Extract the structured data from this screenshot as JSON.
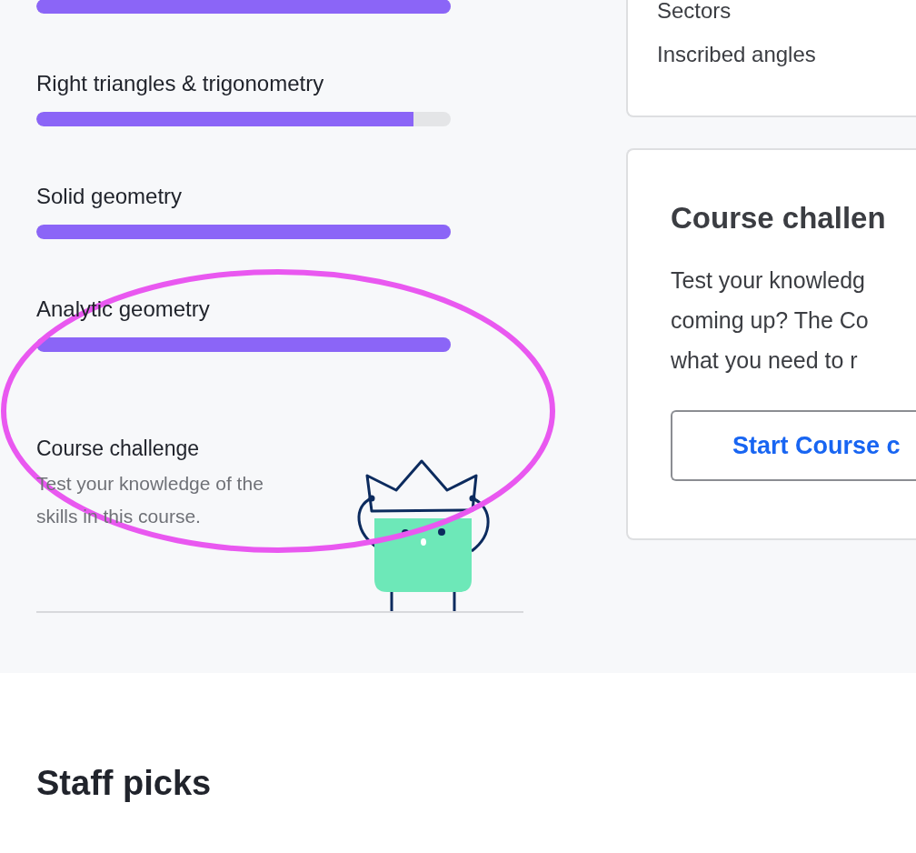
{
  "skills": [
    {
      "level": 1
    },
    {
      "name": "Right triangles & trigonometry",
      "level": 0.91
    },
    {
      "name": "Solid geometry",
      "level": 1
    },
    {
      "name": "Analytic geometry",
      "level": 1
    }
  ],
  "course_challenge": {
    "title": "Course challenge",
    "description": "Test your knowledge of the skills in this course."
  },
  "unit_card": {
    "lessons": [
      "Sectors",
      "Inscribed angles"
    ]
  },
  "challenge_card": {
    "title": "Course challen",
    "description_lines": [
      "Test your knowledg",
      "coming up? The Co",
      "what you need to r"
    ],
    "button": "Start Course c"
  },
  "staff_picks": {
    "title": "Staff picks"
  }
}
